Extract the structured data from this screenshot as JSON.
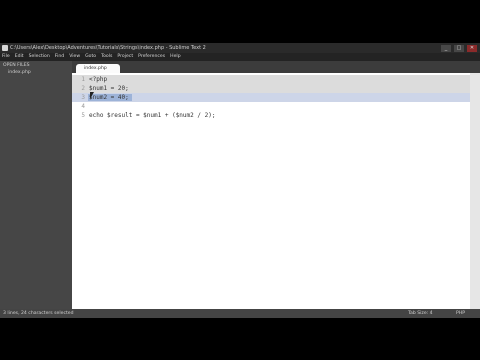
{
  "window": {
    "title": "C:\\Users\\Alex\\Desktop\\Adventures\\Tutorials\\Strings\\index.php - Sublime Text 2",
    "buttons": {
      "minimize": "_",
      "maximize": "□",
      "close": "✕"
    }
  },
  "menu": [
    "File",
    "Edit",
    "Selection",
    "Find",
    "View",
    "Goto",
    "Tools",
    "Project",
    "Preferences",
    "Help"
  ],
  "sidebar": {
    "header": "OPEN FILES",
    "file": "index.php"
  },
  "tab": {
    "label": "index.php"
  },
  "code": {
    "lines": [
      {
        "num": "1",
        "text": "<?php"
      },
      {
        "num": "2",
        "text": "$num1 = 20;"
      },
      {
        "num": "3",
        "text": "$num2 = 40;"
      },
      {
        "num": "4",
        "text": ""
      },
      {
        "num": "5",
        "text": "echo $result = $num1 + ($num2 / 2);"
      }
    ]
  },
  "status": {
    "left": "3 lines, 24 characters selected",
    "tab_size": "Tab Size: 4",
    "syntax": "PHP"
  },
  "colors": {
    "selection": "#9db3d8",
    "sidebar": "#464646",
    "window": "#3c3c3c"
  }
}
